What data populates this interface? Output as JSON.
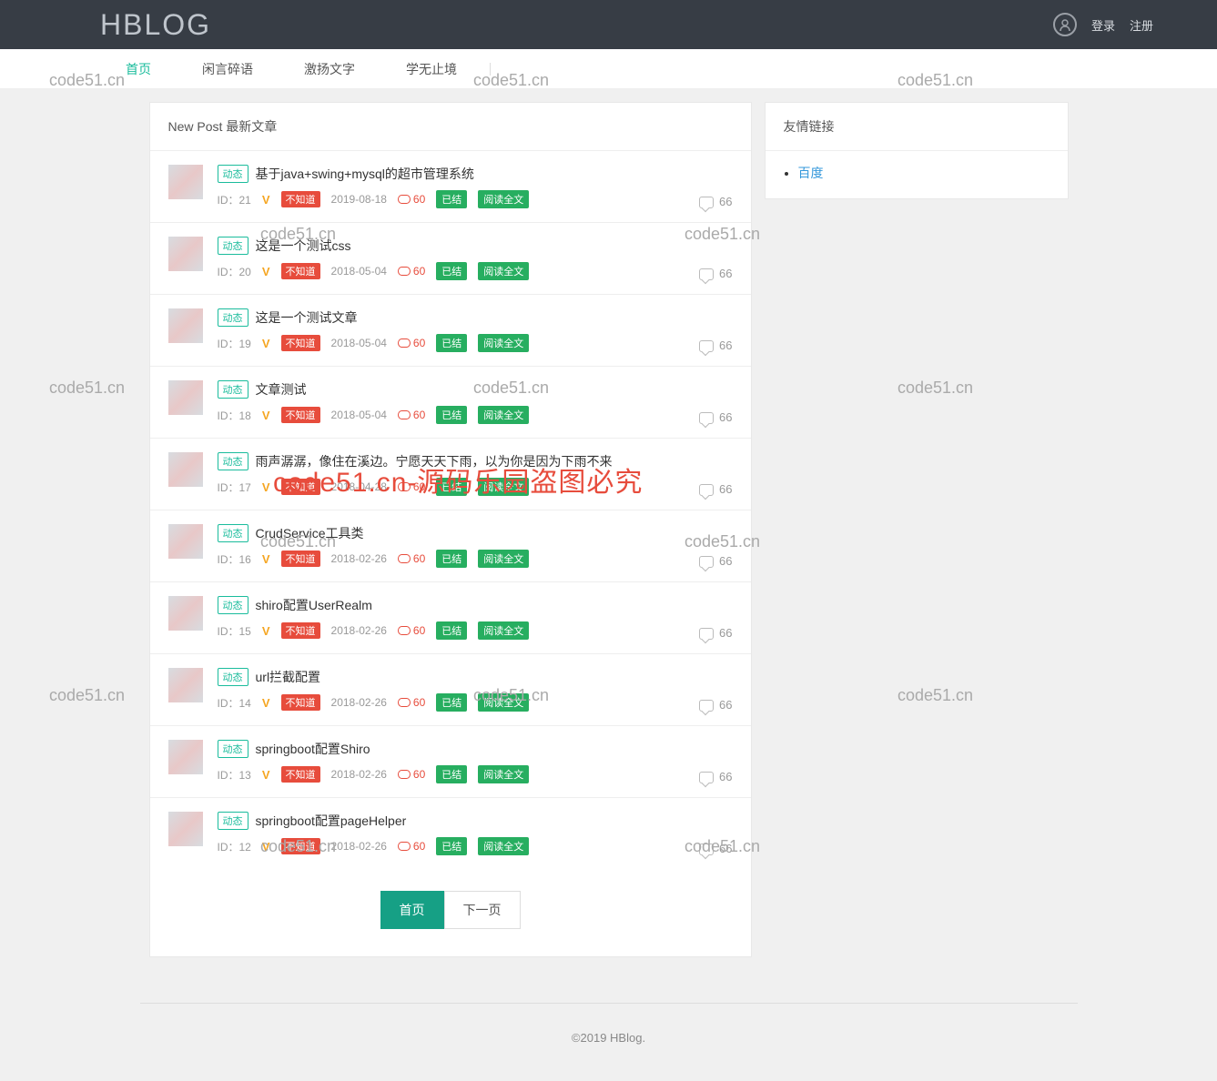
{
  "header": {
    "logo": "HBLOG",
    "login": "登录",
    "register": "注册"
  },
  "nav": {
    "items": [
      "首页",
      "闲言碎语",
      "激扬文字",
      "学无止境"
    ],
    "active_index": 0
  },
  "main": {
    "panel_title": "New Post 最新文章",
    "posts": [
      {
        "tag": "动态",
        "title": "基于java+swing+mysql的超市管理系统",
        "id": "21",
        "unknown": "不知道",
        "date": "2019-08-18",
        "views": "60",
        "status": "已结",
        "read": "阅读全文",
        "comments": "66"
      },
      {
        "tag": "动态",
        "title": "这是一个测试css",
        "id": "20",
        "unknown": "不知道",
        "date": "2018-05-04",
        "views": "60",
        "status": "已结",
        "read": "阅读全文",
        "comments": "66"
      },
      {
        "tag": "动态",
        "title": "这是一个测试文章",
        "id": "19",
        "unknown": "不知道",
        "date": "2018-05-04",
        "views": "60",
        "status": "已结",
        "read": "阅读全文",
        "comments": "66"
      },
      {
        "tag": "动态",
        "title": "文章测试",
        "id": "18",
        "unknown": "不知道",
        "date": "2018-05-04",
        "views": "60",
        "status": "已结",
        "read": "阅读全文",
        "comments": "66"
      },
      {
        "tag": "动态",
        "title": "雨声潺潺，像住在溪边。宁愿天天下雨，以为你是因为下雨不来",
        "id": "17",
        "unknown": "不知道",
        "date": "2018-04-28",
        "views": "60",
        "status": "已结",
        "read": "阅读全文",
        "comments": "66"
      },
      {
        "tag": "动态",
        "title": "CrudService工具类",
        "id": "16",
        "unknown": "不知道",
        "date": "2018-02-26",
        "views": "60",
        "status": "已结",
        "read": "阅读全文",
        "comments": "66"
      },
      {
        "tag": "动态",
        "title": "shiro配置UserRealm",
        "id": "15",
        "unknown": "不知道",
        "date": "2018-02-26",
        "views": "60",
        "status": "已结",
        "read": "阅读全文",
        "comments": "66"
      },
      {
        "tag": "动态",
        "title": "url拦截配置",
        "id": "14",
        "unknown": "不知道",
        "date": "2018-02-26",
        "views": "60",
        "status": "已结",
        "read": "阅读全文",
        "comments": "66"
      },
      {
        "tag": "动态",
        "title": "springboot配置Shiro",
        "id": "13",
        "unknown": "不知道",
        "date": "2018-02-26",
        "views": "60",
        "status": "已结",
        "read": "阅读全文",
        "comments": "66"
      },
      {
        "tag": "动态",
        "title": "springboot配置pageHelper",
        "id": "12",
        "unknown": "不知道",
        "date": "2018-02-26",
        "views": "60",
        "status": "已结",
        "read": "阅读全文",
        "comments": "66"
      }
    ],
    "id_label": "ID：",
    "vip_symbol": "V"
  },
  "pagination": {
    "first": "首页",
    "next": "下一页"
  },
  "sidebar": {
    "links_title": "友情链接",
    "links": [
      {
        "label": "百度"
      }
    ]
  },
  "footer": "©2019 HBlog.",
  "watermarks": {
    "text": "code51.cn",
    "red": "code51.cn-源码乐园盗图必究"
  }
}
